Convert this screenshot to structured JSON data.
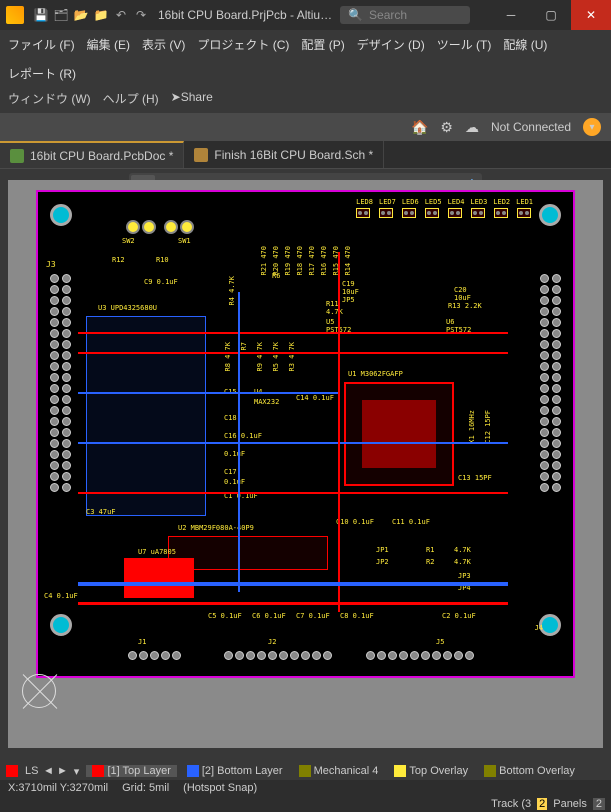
{
  "titlebar": {
    "title": "16bit CPU Board.PrjPcb - Altiu…",
    "search_placeholder": "Search"
  },
  "menu": {
    "items": [
      "ファイル (F)",
      "編集 (E)",
      "表示 (V)",
      "プロジェクト (C)",
      "配置 (P)",
      "デザイン (D)",
      "ツール (T)",
      "配線 (U)",
      "レポート (R)"
    ],
    "items2": [
      "ウィンドウ (W)",
      "ヘルプ (H)"
    ],
    "share": "Share"
  },
  "conn": {
    "status": "Not Connected"
  },
  "tabs": [
    {
      "label": "16bit CPU Board.PcbDoc *",
      "active": true,
      "kind": "pcb"
    },
    {
      "label": "Finish 16Bit CPU Board.Sch *",
      "active": false,
      "kind": "sch"
    }
  ],
  "layers": {
    "ls": "LS",
    "items": [
      {
        "name": "[1] Top Layer",
        "color": "#ff0000",
        "active": true
      },
      {
        "name": "[2] Bottom Layer",
        "color": "#2962ff",
        "active": false
      },
      {
        "name": "Mechanical 4",
        "color": "#808000",
        "active": false
      },
      {
        "name": "Top Overlay",
        "color": "#ffeb3b",
        "active": false
      },
      {
        "name": "Bottom Overlay",
        "color": "#808000",
        "active": false
      }
    ]
  },
  "status": {
    "coords": "X:3710mil Y:3270mil",
    "grid": "Grid: 5mil",
    "snap": "(Hotspot Snap)",
    "track": "Track (3",
    "panels": "Panels"
  },
  "silk": {
    "leds": [
      "LED8",
      "LED7",
      "LED6",
      "LED5",
      "LED4",
      "LED3",
      "LED2",
      "LED1"
    ],
    "j3": "J3",
    "sw2": "SW2",
    "sw1": "SW1",
    "r12": "R12",
    "r10": "R10",
    "c9": "C9  0.1uF",
    "u3": "U3  UPD4325680U",
    "r21": "R21 470",
    "r20": "R20 470",
    "r19": "R19 470",
    "r18": "R18 470",
    "r17": "R17 470",
    "r16": "R16 470",
    "r15": "R15 470",
    "r14": "R14 470",
    "r6": "R6",
    "r4": "R4 4.7K",
    "c19": "C19",
    "c19v": "10uF",
    "jp5": "JP5",
    "c20": "C20",
    "c20v": "10uF",
    "r13": "R13  2.2K",
    "r11": "R11",
    "r11v": "4.7K",
    "u5": "U5",
    "u6": "U6",
    "pst1": "PST572",
    "pst2": "PST572",
    "r7": "R7",
    "r8": "R8 4.7K",
    "r9": "R9 4.7K",
    "r5": "R5 4.7K",
    "r3": "R3 4.7K",
    "u1": "U1  M3062FGAFP",
    "c15": "C15",
    "u4": "U4",
    "max": "MAX232",
    "c14": "C14 0.1uF",
    "c16": "C16 0.1uF",
    "c18": "C18",
    "c16b": "0.1uF",
    "c17": "C17",
    "c17b": "0.1uF",
    "c1": "C1 0.1uF",
    "x1": "X1 16MHz",
    "c12": "C12 15PF",
    "c13": "C13 15PF",
    "c3": "C3 47uF",
    "c10": "C10 0.1uF",
    "c11": "C11 0.1uF",
    "u2": "U2  MBM29F080A-40P9",
    "u7": "U7  uA7805",
    "jp1": "JP1",
    "jp2": "JP2",
    "r1": "R1",
    "r2": "R2",
    "r1v": "4.7K",
    "r2v": "4.7K",
    "jp3": "JP3",
    "jp4": "JP4",
    "c4": "C4  0.1uF",
    "c5": "C5 0.1uF",
    "c6": "C6 0.1uF",
    "c7": "C7 0.1uF",
    "c8": "C8 0.1uF",
    "c2": "C2 0.1uF",
    "j1": "J1",
    "j2": "J2",
    "j5": "J5",
    "j4": "J4"
  }
}
